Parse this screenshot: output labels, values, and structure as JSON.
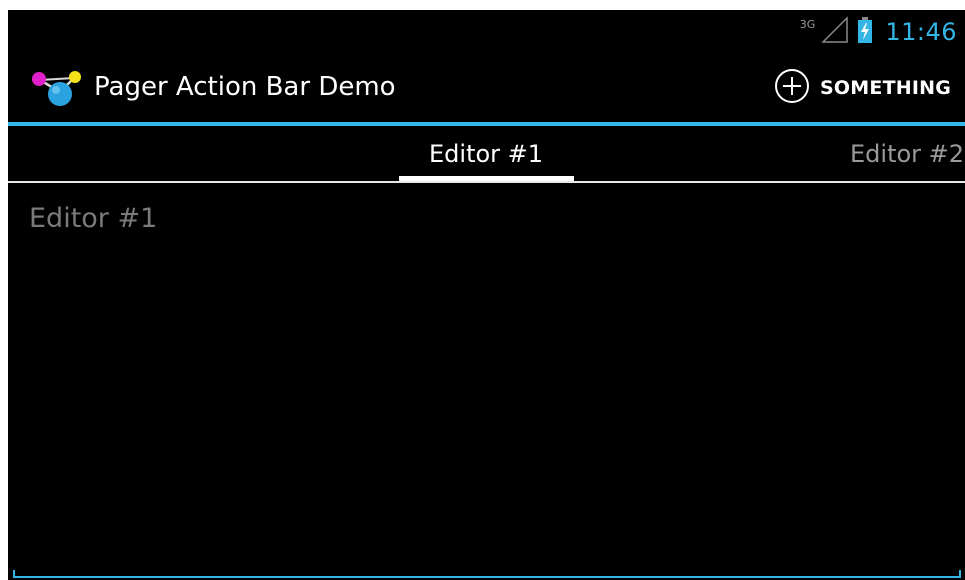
{
  "status_bar": {
    "network_type": "3G",
    "signal_icon": "signal-strength-icon",
    "battery_icon": "battery-charging-icon",
    "time": "11:46"
  },
  "action_bar": {
    "app_icon": "pager-demo-app-icon",
    "title": "Pager Action Bar Demo",
    "action_icon": "add-circle-icon",
    "action_label": "SOMETHING"
  },
  "tabs": [
    {
      "label": "Editor #1",
      "selected": true
    },
    {
      "label": "Editor #2",
      "selected": false
    }
  ],
  "editor": {
    "placeholder": "Editor #1",
    "value": ""
  },
  "colors": {
    "accent": "#33b5e5",
    "background": "#000000",
    "text_primary": "#ffffff",
    "text_secondary": "#9a9a9a",
    "hint": "#7a7a7a"
  }
}
